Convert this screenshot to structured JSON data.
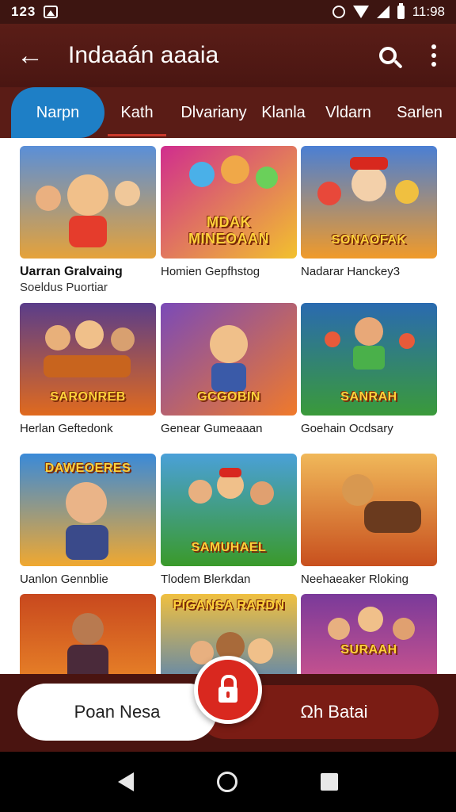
{
  "status": {
    "time": "123",
    "clock": "11:98"
  },
  "appbar": {
    "title": "Indaaán aaaia"
  },
  "tabs": [
    {
      "label": "Narpn"
    },
    {
      "label": "Kath"
    },
    {
      "label": "Dlvariany"
    },
    {
      "label": "Klanla"
    },
    {
      "label": "Vldarn"
    },
    {
      "label": "Sarlen"
    }
  ],
  "cards": [
    {
      "title": "Uarran Gralvaing",
      "subtitle": "Soeldus Puortiar",
      "banner": "",
      "colors": [
        "#5a8fd8",
        "#e5a23a"
      ]
    },
    {
      "title": "Homien Gepfhstog",
      "subtitle": "",
      "banner": "MDAK MINEOAAN",
      "colors": [
        "#d02d8e",
        "#f2c12e"
      ]
    },
    {
      "title": "Nadarar Hanckey3",
      "subtitle": "",
      "banner": "SONAOFAK",
      "colors": [
        "#4a7fd4",
        "#f09a2a"
      ]
    },
    {
      "title": "Herlan Geftedonk",
      "subtitle": "",
      "banner": "SARONREB",
      "colors": [
        "#5a3d8a",
        "#e06a1e"
      ]
    },
    {
      "title": "Genear Gumeaaan",
      "subtitle": "",
      "banner": "GCGOBIN",
      "colors": [
        "#7a4ab8",
        "#f07a2a"
      ]
    },
    {
      "title": "Goehain Ocdsary",
      "subtitle": "",
      "banner": "SANRAH",
      "colors": [
        "#2a6ab0",
        "#3a9a3a"
      ]
    },
    {
      "title": "Uanlon Gennblie",
      "subtitle": "",
      "banner": "DAWEOERES",
      "colors": [
        "#3a8ad8",
        "#f0a830"
      ]
    },
    {
      "title": "Tlodem Blerkdan",
      "subtitle": "",
      "banner": "SAMUHAEL",
      "colors": [
        "#4aa0d8",
        "#3a9a2a"
      ]
    },
    {
      "title": "Neehaeaker Rloking",
      "subtitle": "",
      "banner": "",
      "colors": [
        "#f0b85a",
        "#c8501e"
      ]
    },
    {
      "title": "",
      "subtitle": "",
      "banner": "",
      "colors": [
        "#c8481e",
        "#f0922a"
      ]
    },
    {
      "title": "",
      "subtitle": "",
      "banner": "PIGANSA RARDN",
      "colors": [
        "#f0c040",
        "#3a78c8"
      ]
    },
    {
      "title": "",
      "subtitle": "",
      "banner": "SURAAH",
      "colors": [
        "#7a3a9a",
        "#e05a8a"
      ]
    }
  ],
  "bottom": {
    "left_label": "Poan Nesa",
    "right_label": "Ωh Batai"
  }
}
